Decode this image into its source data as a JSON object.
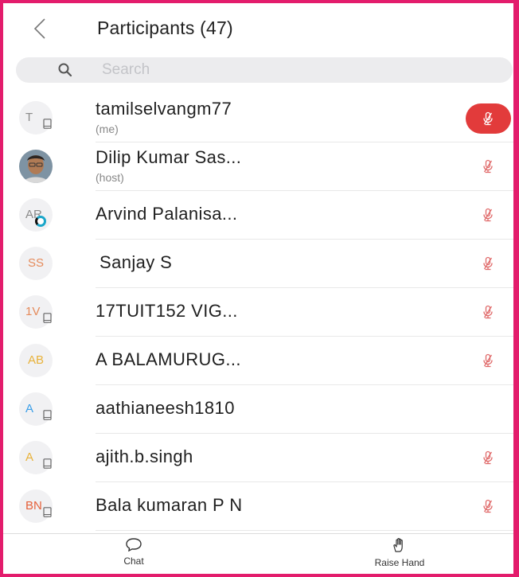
{
  "header": {
    "title": "Participants (47)",
    "back_icon": "chevron-left-icon"
  },
  "search": {
    "placeholder": "Search",
    "icon": "search-icon"
  },
  "participants": [
    {
      "initials": "T",
      "initials_color": "#8a8a8a",
      "device": "phone",
      "name": "tamilselvangm77",
      "sub": "(me)",
      "mic": "muted-active"
    },
    {
      "initials": "",
      "photo": true,
      "name": "Dilip Kumar Sas...",
      "sub": "(host)",
      "mic": "muted"
    },
    {
      "initials": "AR",
      "initials_color": "#8a8a8a",
      "badge": "ring",
      "name": "Arvind Palanisa...",
      "sub": "",
      "mic": "muted"
    },
    {
      "initials": "SS",
      "initials_color": "#e58a5a",
      "name": "Sanjay S",
      "sub": "",
      "mic": "muted"
    },
    {
      "initials": "1V",
      "initials_color": "#e58a5a",
      "device": "phone",
      "name": "17TUIT152 VIG...",
      "sub": "",
      "mic": "muted"
    },
    {
      "initials": "AB",
      "initials_color": "#e8b23a",
      "name": "A BALAMURUG...",
      "sub": "",
      "mic": "muted"
    },
    {
      "initials": "A",
      "initials_color": "#3a9ee8",
      "device": "phone",
      "name": "aathianeesh1810",
      "sub": "",
      "mic": "none"
    },
    {
      "initials": "A",
      "initials_color": "#e8b23a",
      "device": "phone",
      "name": "ajith.b.singh",
      "sub": "",
      "mic": "muted"
    },
    {
      "initials": "BN",
      "initials_color": "#e5603a",
      "device": "phone",
      "name": "Bala kumaran P N",
      "sub": "",
      "mic": "muted"
    }
  ],
  "tabbar": {
    "chat": {
      "label": "Chat",
      "icon": "chat-bubble-icon"
    },
    "raise_hand": {
      "label": "Raise Hand",
      "icon": "raise-hand-icon"
    }
  },
  "colors": {
    "accent_red": "#e23b3b",
    "muted_mic": "#e06a6a",
    "frame_border": "#e31c6c"
  }
}
